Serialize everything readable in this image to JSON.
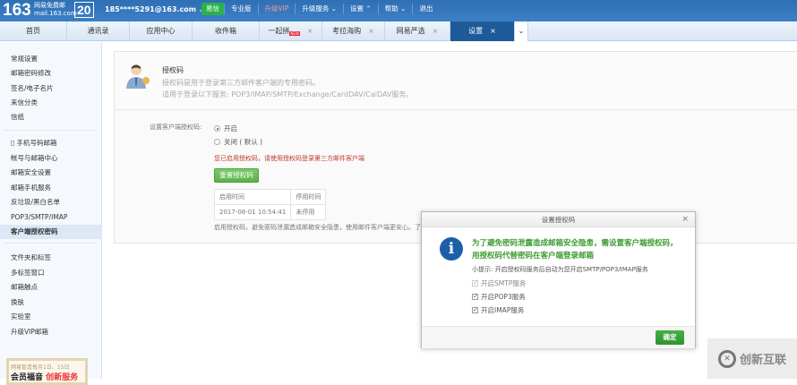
{
  "header": {
    "logo": "163",
    "logo_line1": "网易免费邮",
    "logo_line2": "mail.163.com",
    "badge": "20",
    "account": "185****5291@163.com ⌄",
    "nav": [
      "易信",
      "专业版",
      "升级VIP",
      "升级服务 ⌄",
      "设置 ⌃",
      "帮助 ⌄",
      "退出"
    ]
  },
  "tabs": [
    {
      "label": "首页"
    },
    {
      "label": "通讯录"
    },
    {
      "label": "应用中心"
    },
    {
      "label": "收件箱"
    },
    {
      "label": "一起拼",
      "badge": "NEW"
    },
    {
      "label": "考拉海购"
    },
    {
      "label": "网易严选"
    },
    {
      "label": "设置"
    }
  ],
  "tab_close": "×",
  "tab_more": "⌄",
  "sidebar": {
    "group1": [
      "常规设置",
      "邮箱密码修改",
      "签名/电子名片",
      "来信分类",
      "信纸"
    ],
    "group2": [
      "手机号码邮箱",
      "帐号与邮箱中心",
      "邮箱安全设置",
      "邮箱手机服务",
      "反垃圾/黑白名单",
      "POP3/SMTP/IMAP",
      "客户端授权密码"
    ],
    "group3": [
      "文件夹和标签",
      "多标签窗口",
      "邮箱触点",
      "换肤",
      "实验室",
      "升级VIP邮箱"
    ],
    "ad_line1": "网易智造每月1日、15日",
    "ad_line2": "会员福音",
    "ad_line3": "创新服务"
  },
  "main": {
    "title": "授权码",
    "desc1": "授权码是用于登录第三方邮件客户端的专用密码。",
    "desc2": "适用于登录以下服务: POP3/IMAP/SMTP/Exchange/CardDAV/CalDAV服务。",
    "setting_label": "设置客户端授权码:",
    "radio_on": "开启",
    "radio_off": "关闭 ( 默认 )",
    "warning": "您已启用授权码，请使用授权码登录第三方邮件客户端",
    "reset_button": "重置授权码",
    "table_headers": [
      "启用时间",
      "停用时间"
    ],
    "table_row": [
      "2017-08-01 10:54:41",
      "未停用"
    ],
    "note": "启用授权码，避免密码泄漏造成邮箱安全隐患，使用邮件客户端更安心。了"
  },
  "dialog": {
    "title": "设置授权码",
    "close": "×",
    "message": "为了避免密码泄露造成邮箱安全隐患，需设置客户端授权码，用授权码代替密码在客户端登录邮箱",
    "tip": "小提示: 开启授权码服务后自动为您开启SMTP/POP3/IMAP服务",
    "options": [
      {
        "label": "开启SMTP服务",
        "checked": true,
        "disabled": true
      },
      {
        "label": "开启POP3服务",
        "checked": true
      },
      {
        "label": "开启IMAP服务",
        "checked": true
      }
    ],
    "ok": "确定"
  },
  "watermark": "创新互联"
}
